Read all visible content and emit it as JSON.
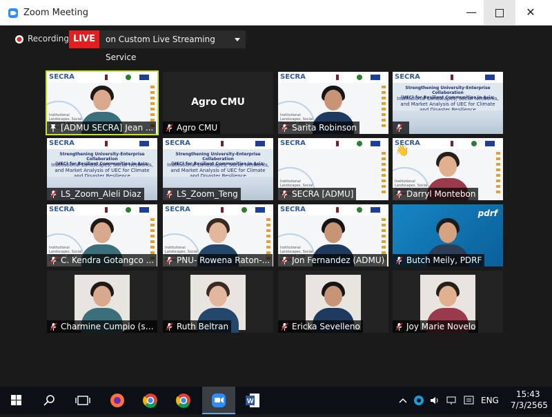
{
  "window": {
    "title": "Zoom Meeting",
    "controls": {
      "minimize": "—",
      "close": "✕"
    }
  },
  "recording_bar": {
    "recording_label": "Recording",
    "live_label": "LIVE",
    "stream_target": "on Custom Live Streaming Service"
  },
  "tiles": [
    {
      "name": "[ADMU SECRA] Jean ...",
      "kind": "webcam-slide",
      "speaking": true,
      "pinned": true
    },
    {
      "name": "Agro CMU",
      "kind": "no-video",
      "big_label": "Agro CMU"
    },
    {
      "name": "Sarita Robinson",
      "kind": "webcam-slide"
    },
    {
      "name": "",
      "kind": "title-slide"
    },
    {
      "name": "LS_Zoom_Aleli Diaz",
      "kind": "title-slide"
    },
    {
      "name": "LS_Zoom_Teng",
      "kind": "title-slide"
    },
    {
      "name": "SECRA [ADMU]",
      "kind": "slide"
    },
    {
      "name": "Darryl Montebon",
      "kind": "webcam-slide",
      "reaction": "👋"
    },
    {
      "name": "C. Kendra Gotangco ...",
      "kind": "webcam-slide"
    },
    {
      "name": "PNU- Rowena Raton-...",
      "kind": "webcam-slide"
    },
    {
      "name": "Jon Fernandez (ADMU)",
      "kind": "webcam-slide"
    },
    {
      "name": "Butch Meily, PDRF",
      "kind": "webcam-pdrf",
      "logo": "pdrf"
    },
    {
      "name": "Charmine Cumpio (sh...",
      "kind": "photo"
    },
    {
      "name": "Ruth Beltran",
      "kind": "photo"
    },
    {
      "name": "Ericka Sevelleno",
      "kind": "photo"
    },
    {
      "name": "Joy Marie Novelo",
      "kind": "photo"
    }
  ],
  "slide_content": {
    "brand": "SECRA",
    "title_line1": "Strengthening University-Enterprise Collaboration",
    "title_line2": "(UEC) for Resilient Communities in Asia:",
    "subtitle": "Institutional Landscapes, Social Networks, and Market Analysis of UEC for Climate and Disaster Resilience",
    "side_note": "Institutional Landscapes, Social Networks, and Market"
  },
  "taskbar": {
    "language": "ENG",
    "time": "15:43",
    "date": "7/3/2565"
  },
  "colors": {
    "live": "#e02020",
    "speaker_highlight": "#c7e22a",
    "zoom_blue": "#2d8cff",
    "mute_red": "#e02020"
  }
}
